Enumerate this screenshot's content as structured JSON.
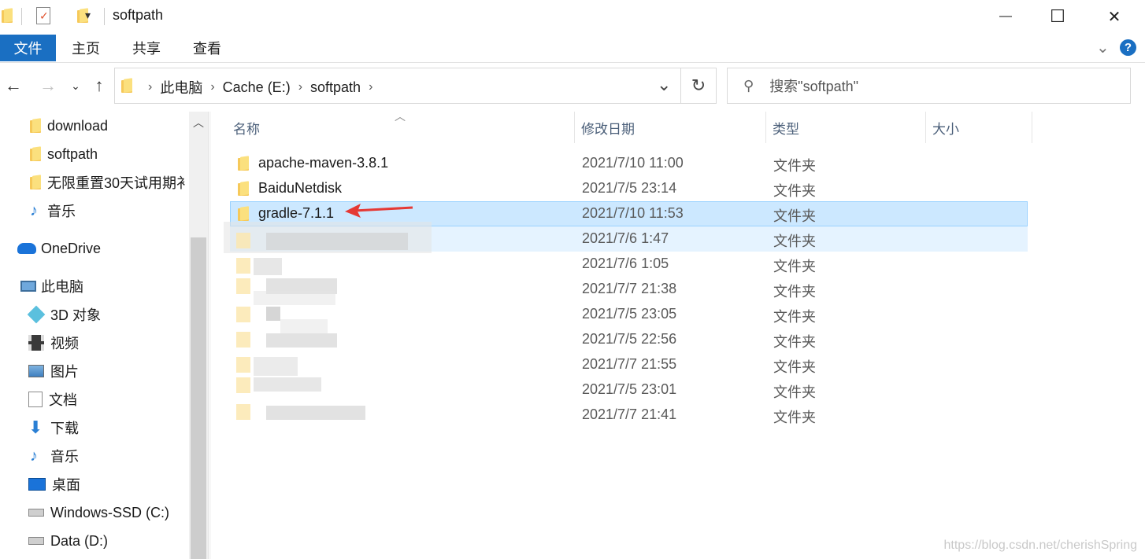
{
  "window": {
    "title": "softpath",
    "controls": {
      "minimize": "—",
      "maximize": "☐",
      "close": "✕"
    }
  },
  "ribbon": {
    "tabs": [
      "文件",
      "主页",
      "共享",
      "查看"
    ],
    "active_tab": "文件",
    "help": "?",
    "expand": "⌄"
  },
  "address": {
    "breadcrumbs": [
      "此电脑",
      "Cache (E:)",
      "softpath"
    ],
    "search_placeholder": "搜索\"softpath\""
  },
  "nav": {
    "items": [
      {
        "label": "download",
        "icon": "folder-icon"
      },
      {
        "label": "softpath",
        "icon": "folder-icon"
      },
      {
        "label": "无限重置30天试用期衤",
        "icon": "folder-icon"
      },
      {
        "label": "音乐",
        "icon": "music-icon"
      },
      {
        "label": "OneDrive",
        "icon": "cloud-icon"
      },
      {
        "label": "此电脑",
        "icon": "computer-icon"
      },
      {
        "label": "3D 对象",
        "icon": "cube-icon"
      },
      {
        "label": "视频",
        "icon": "video-icon"
      },
      {
        "label": "图片",
        "icon": "picture-icon"
      },
      {
        "label": "文档",
        "icon": "document-icon"
      },
      {
        "label": "下载",
        "icon": "download-icon"
      },
      {
        "label": "音乐",
        "icon": "music-icon"
      },
      {
        "label": "桌面",
        "icon": "desktop-icon"
      },
      {
        "label": "Windows-SSD (C:)",
        "icon": "drive-icon"
      },
      {
        "label": "Data (D:)",
        "icon": "drive-icon"
      }
    ]
  },
  "filelist": {
    "columns": [
      "名称",
      "修改日期",
      "类型",
      "大小"
    ],
    "rows": [
      {
        "name": "apache-maven-3.8.1",
        "date": "2021/7/10 11:00",
        "type": "文件夹"
      },
      {
        "name": "BaiduNetdisk",
        "date": "2021/7/5 23:14",
        "type": "文件夹"
      },
      {
        "name": "gradle-7.1.1",
        "date": "2021/7/10 11:53",
        "type": "文件夹",
        "selected": true
      },
      {
        "name": "",
        "date": "2021/7/6 1:47",
        "type": "文件夹"
      },
      {
        "name": "",
        "date": "2021/7/6 1:05",
        "type": "文件夹"
      },
      {
        "name": "",
        "date": "2021/7/7 21:38",
        "type": "文件夹"
      },
      {
        "name": "",
        "date": "2021/7/5 23:05",
        "type": "文件夹"
      },
      {
        "name": "",
        "date": "2021/7/5 22:56",
        "type": "文件夹"
      },
      {
        "name": "",
        "date": "2021/7/7 21:55",
        "type": "文件夹"
      },
      {
        "name": "",
        "date": "2021/7/5 23:01",
        "type": "文件夹"
      },
      {
        "name": "",
        "date": "2021/7/7 21:41",
        "type": "文件夹"
      }
    ]
  },
  "watermark": "https://blog.csdn.net/cherishSpring",
  "colors": {
    "accent": "#1a6fc2",
    "selection": "#cce8ff",
    "annotation_arrow": "#e53935"
  }
}
